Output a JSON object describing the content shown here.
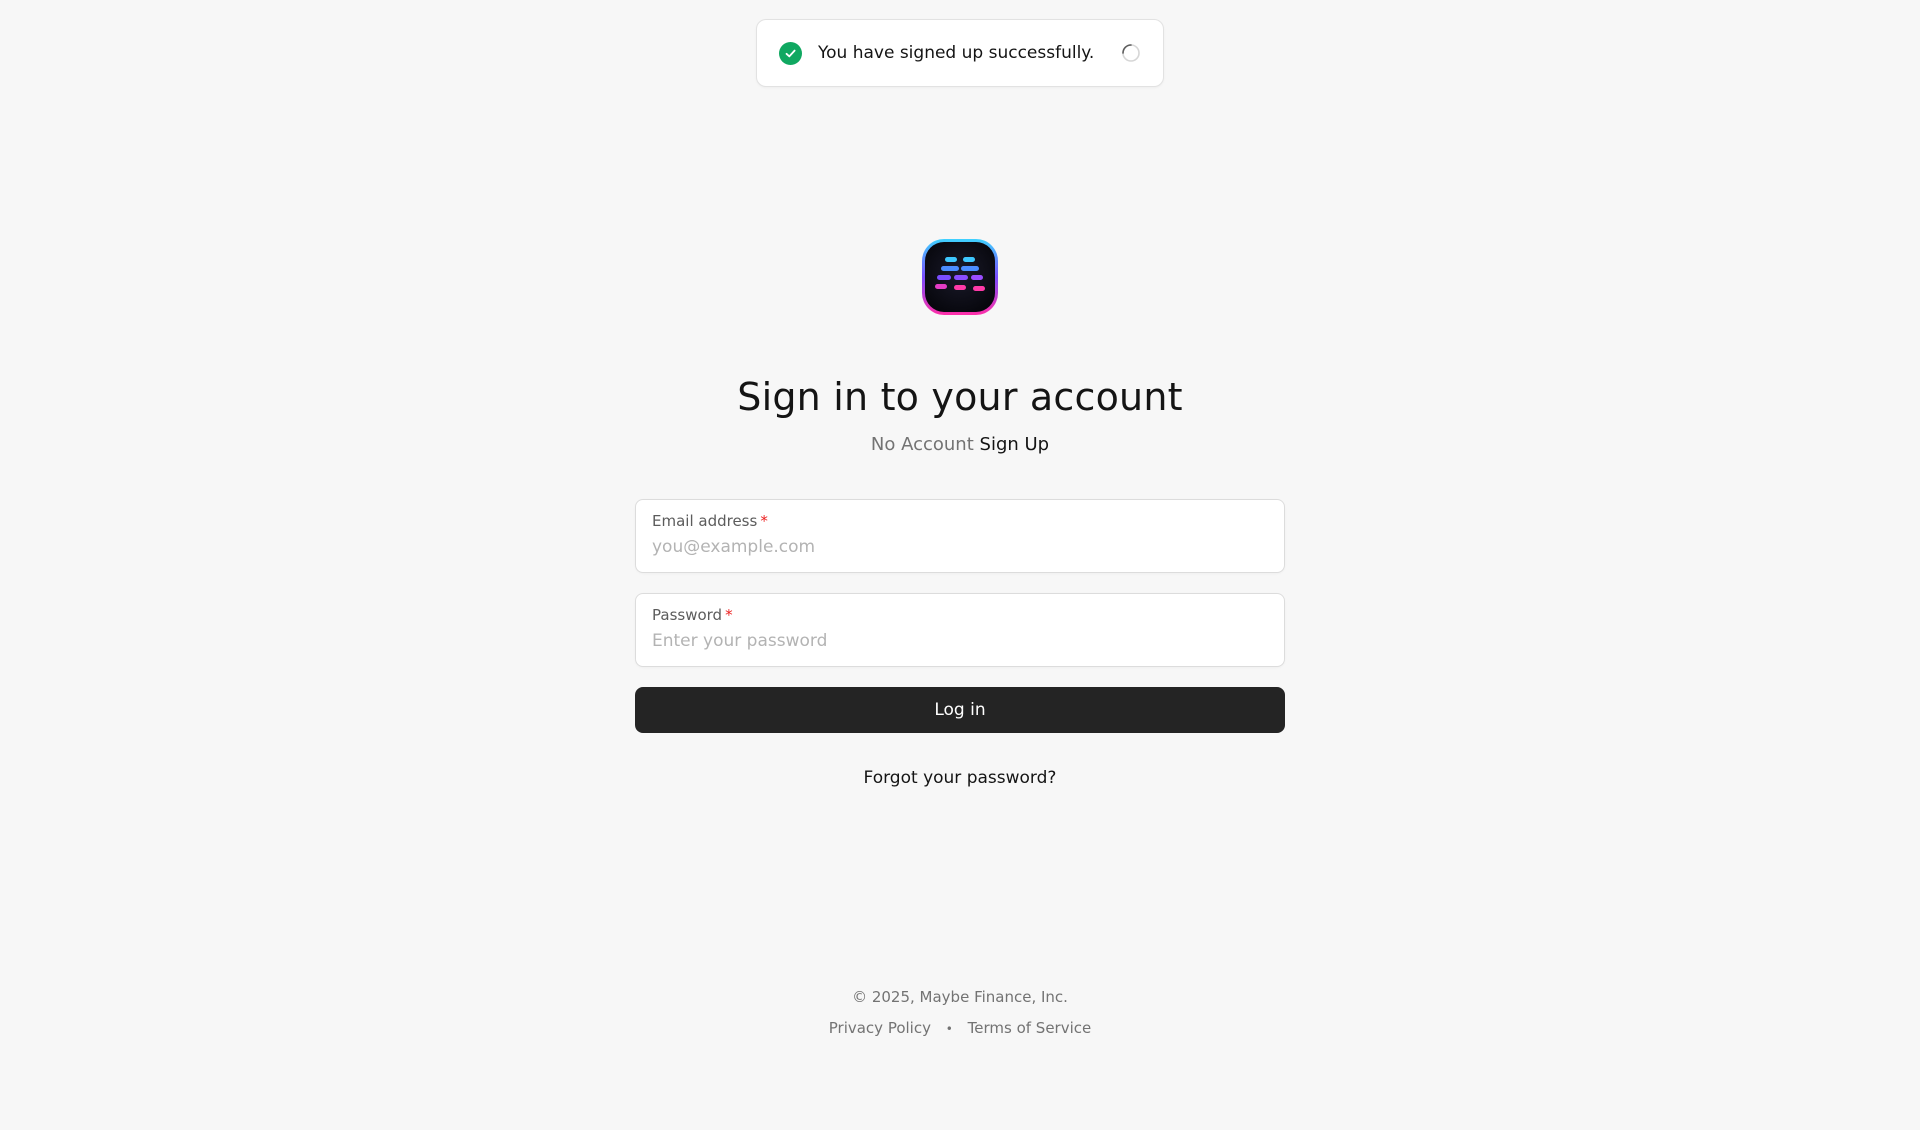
{
  "toast": {
    "message": "You have signed up successfully.",
    "icon": "check-circle-icon",
    "status_color": "#10a861"
  },
  "logo": {
    "icon": "maybe-app-logo"
  },
  "heading": {
    "title": "Sign in to your account",
    "no_account_text": "No Account",
    "sign_up_link": "Sign Up"
  },
  "form": {
    "email": {
      "label": "Email address",
      "required_mark": "*",
      "value": "",
      "placeholder": "you@example.com"
    },
    "password": {
      "label": "Password",
      "required_mark": "*",
      "value": "",
      "placeholder": "Enter your password"
    },
    "submit_label": "Log in",
    "forgot_link": "Forgot your password?"
  },
  "footer": {
    "copyright": "© 2025, Maybe Finance, Inc.",
    "privacy_link": "Privacy Policy",
    "separator": "•",
    "terms_link": "Terms of Service"
  },
  "colors": {
    "background": "#f7f7f7",
    "primary_button": "#242424",
    "required": "#ec2222"
  }
}
